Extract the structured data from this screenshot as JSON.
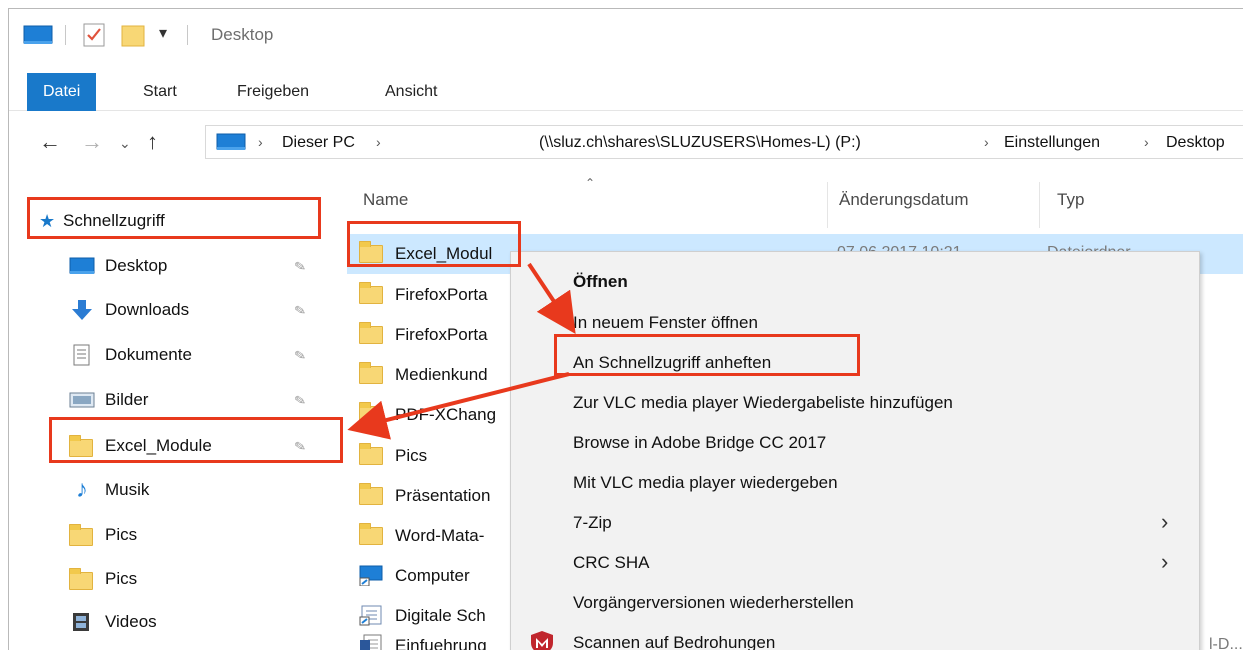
{
  "window": {
    "title": "Desktop"
  },
  "ribbon": {
    "tabs": [
      "Datei",
      "Start",
      "Freigeben",
      "Ansicht"
    ]
  },
  "address": {
    "segments": [
      "Dieser PC",
      "(\\\\sluz.ch\\shares\\SLUZUSERS\\Homes-L) (P:)",
      "Einstellungen",
      "Desktop"
    ]
  },
  "sidebar": {
    "quick_access": "Schnellzugriff",
    "items": [
      {
        "label": "Desktop",
        "icon": "desktop-icon",
        "pinned": true
      },
      {
        "label": "Downloads",
        "icon": "download-arrow-icon",
        "pinned": true
      },
      {
        "label": "Dokumente",
        "icon": "documents-icon",
        "pinned": true
      },
      {
        "label": "Bilder",
        "icon": "pictures-icon",
        "pinned": true
      },
      {
        "label": "Excel_Module",
        "icon": "folder-icon",
        "pinned": true
      },
      {
        "label": "Musik",
        "icon": "music-note-icon",
        "pinned": false
      },
      {
        "label": "Pics",
        "icon": "folder-icon",
        "pinned": false
      },
      {
        "label": "Pics",
        "icon": "folder-icon",
        "pinned": false
      },
      {
        "label": "Videos",
        "icon": "videos-icon",
        "pinned": false
      }
    ]
  },
  "list": {
    "columns": {
      "name": "Name",
      "date": "Änderungsdatum",
      "type": "Typ"
    },
    "rows": [
      {
        "name": "Excel_Modul",
        "icon": "folder-icon",
        "date": "07.06.2017 10:21",
        "type": "Dateiordner",
        "selected": true
      },
      {
        "name": "FirefoxPorta",
        "icon": "folder-icon"
      },
      {
        "name": "FirefoxPorta",
        "icon": "folder-icon"
      },
      {
        "name": "Medienkund",
        "icon": "folder-icon"
      },
      {
        "name": "PDF-XChang",
        "icon": "folder-icon"
      },
      {
        "name": "Pics",
        "icon": "folder-icon"
      },
      {
        "name": "Präsentation",
        "icon": "folder-icon"
      },
      {
        "name": "Word-Mata-",
        "icon": "folder-icon"
      },
      {
        "name": "Computer",
        "icon": "computer-shortcut-icon"
      },
      {
        "name": "Digitale Sch",
        "icon": "shortcut-icon"
      },
      {
        "name": "Einfuehrung",
        "icon": "word-document-icon",
        "type_fragment": "l-D..."
      }
    ]
  },
  "context_menu": {
    "items": [
      {
        "label": "Öffnen",
        "bold": true
      },
      {
        "label": "In neuem Fenster öffnen"
      },
      {
        "label": "An Schnellzugriff anheften",
        "highlighted": true
      },
      {
        "label": "Zur VLC media player Wiedergabeliste hinzufügen"
      },
      {
        "label": "Browse in Adobe Bridge CC 2017"
      },
      {
        "label": "Mit VLC media player wiedergeben"
      },
      {
        "label": "7-Zip",
        "submenu": true
      },
      {
        "label": "CRC SHA",
        "submenu": true
      },
      {
        "label": "Vorgängerversionen wiederherstellen"
      },
      {
        "label": "Scannen auf Bedrohungen",
        "icon": "mcafee-shield-icon"
      }
    ]
  },
  "colors": {
    "accent": "#1979ca",
    "selection": "#cce8ff",
    "highlight_box": "#e8391d",
    "menu_bg": "#f2f2f2",
    "folder": "#f8d775"
  }
}
